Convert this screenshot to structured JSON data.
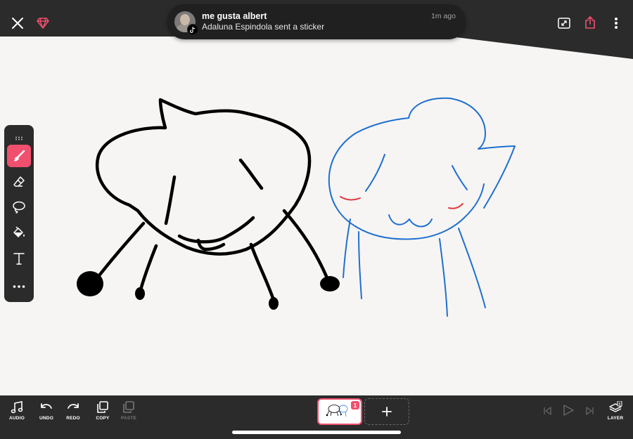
{
  "notification": {
    "sender": "me gusta albert",
    "message": "Adaluna Espindola sent a sticker",
    "time": "1m ago"
  },
  "top_bar": {
    "left_icons": [
      "close-icon",
      "gem-icon"
    ],
    "right_icons": [
      "fullscreen-icon",
      "share-icon",
      "more-vertical-icon"
    ]
  },
  "tools": [
    {
      "id": "brush",
      "icon": "brush-icon",
      "active": true
    },
    {
      "id": "eraser",
      "icon": "eraser-icon",
      "active": false
    },
    {
      "id": "lasso",
      "icon": "lasso-icon",
      "active": false
    },
    {
      "id": "fill",
      "icon": "paint-bucket-icon",
      "active": false
    },
    {
      "id": "text",
      "icon": "text-icon",
      "active": false
    },
    {
      "id": "more",
      "icon": "more-horizontal-icon",
      "active": false
    }
  ],
  "bottom_bar": {
    "audio": "AUDIO",
    "undo": "UNDO",
    "redo": "REDO",
    "copy": "COPY",
    "paste": "PASTE",
    "layer": "LAYER",
    "frame_number": "1"
  },
  "colors": {
    "accent": "#f0506e",
    "ink_black": "#000000",
    "ink_blue": "#1f6fd0",
    "ink_red": "#e03a44",
    "bar": "#2b2b2b",
    "paper": "#f6f5f3"
  }
}
